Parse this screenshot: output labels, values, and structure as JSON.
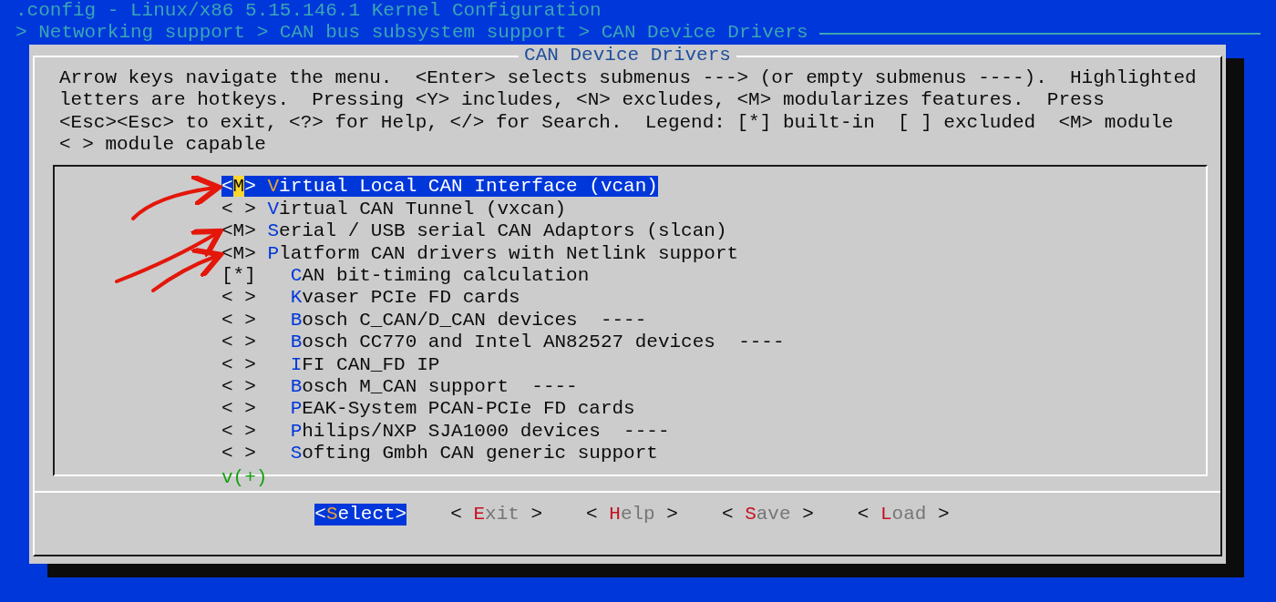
{
  "window": {
    "title": ".config - Linux/x86 5.15.146.1 Kernel Configuration"
  },
  "breadcrumb": "> Networking support > CAN bus subsystem support > CAN Device Drivers",
  "dialog": {
    "title": "CAN Device Drivers",
    "help": [
      "Arrow keys navigate the menu.  <Enter> selects submenus ---> (or empty submenus ----).  Highlighted",
      "letters are hotkeys.  Pressing <Y> includes, <N> excludes, <M> modularizes features.  Press",
      "<Esc><Esc> to exit, <?> for Help, </> for Search.  Legend: [*] built-in  [ ] excluded  <M> module",
      "< > module capable"
    ]
  },
  "menu": {
    "items": [
      {
        "state": "<M>",
        "label": "Virtual Local CAN Interface (vcan)",
        "selected": true
      },
      {
        "state": "< >",
        "label": "Virtual CAN Tunnel (vxcan)",
        "selected": false
      },
      {
        "state": "<M>",
        "label": "Serial / USB serial CAN Adaptors (slcan)",
        "selected": false
      },
      {
        "state": "<M>",
        "label": "Platform CAN drivers with Netlink support",
        "selected": false,
        "children": [
          {
            "state": "[*]",
            "label": "CAN bit-timing calculation",
            "selected": false
          },
          {
            "state": "< >",
            "label": "Kvaser PCIe FD cards",
            "selected": false
          },
          {
            "state": "< >",
            "label": "Bosch C_CAN/D_CAN devices  ----",
            "selected": false
          },
          {
            "state": "< >",
            "label": "Bosch CC770 and Intel AN82527 devices  ----",
            "selected": false
          },
          {
            "state": "< >",
            "label": "IFI CAN_FD IP",
            "selected": false
          },
          {
            "state": "< >",
            "label": "Bosch M_CAN support  ----",
            "selected": false
          },
          {
            "state": "< >",
            "label": "PEAK-System PCAN-PCIe FD cards",
            "selected": false
          },
          {
            "state": "< >",
            "label": "Philips/NXP SJA1000 devices  ----",
            "selected": false
          },
          {
            "state": "< >",
            "label": "Softing Gmbh CAN generic support",
            "selected": false
          }
        ]
      }
    ],
    "more": "v(+)"
  },
  "buttons": [
    {
      "left": "<",
      "label": "Select",
      "right": ">",
      "selected": true
    },
    {
      "left": "< ",
      "label": "Exit",
      "right": " >",
      "selected": false
    },
    {
      "left": "< ",
      "label": "Help",
      "right": " >",
      "selected": false
    },
    {
      "left": "< ",
      "label": "Save",
      "right": " >",
      "selected": false
    },
    {
      "left": "< ",
      "label": "Load",
      "right": " >",
      "selected": false
    }
  ]
}
